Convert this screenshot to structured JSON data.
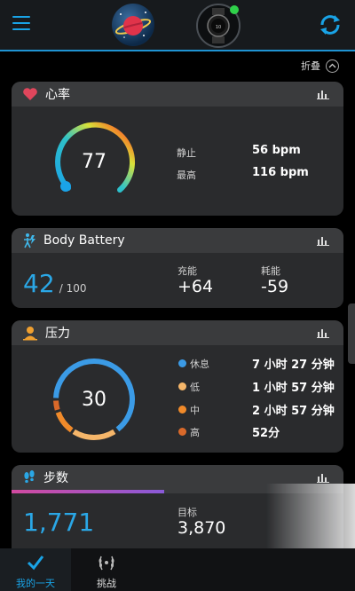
{
  "header": {
    "menu_icon": "menu-icon",
    "sync_icon": "sync-icon"
  },
  "collapse_label": "折叠",
  "heart": {
    "title": "心率",
    "value": "77",
    "resting_label": "静止",
    "resting_value": "56 bpm",
    "max_label": "最高",
    "max_value": "116 bpm"
  },
  "body_battery": {
    "title": "Body Battery",
    "value": "42",
    "max": "/ 100",
    "charged_label": "充能",
    "charged_value": "+64",
    "drained_label": "耗能",
    "drained_value": "-59"
  },
  "stress": {
    "title": "压力",
    "value": "30",
    "items": [
      {
        "label": "休息",
        "value": "7 小时 27 分钟",
        "color": "#3b9be6"
      },
      {
        "label": "低",
        "value": "1 小时 57 分钟",
        "color": "#f5b66a"
      },
      {
        "label": "中",
        "value": "2 小时 57 分钟",
        "color": "#f08a2a"
      },
      {
        "label": "高",
        "value": "52分",
        "color": "#d9692a"
      }
    ]
  },
  "steps": {
    "title": "步数",
    "value": "1,771",
    "goal_label": "目标",
    "goal_value": "3,870",
    "progress": 0.46
  },
  "nav": {
    "my_day": "我的一天",
    "challenges": "挑战"
  },
  "colors": {
    "accent": "#1f93d2",
    "steps_blue": "#2aa7e6"
  }
}
